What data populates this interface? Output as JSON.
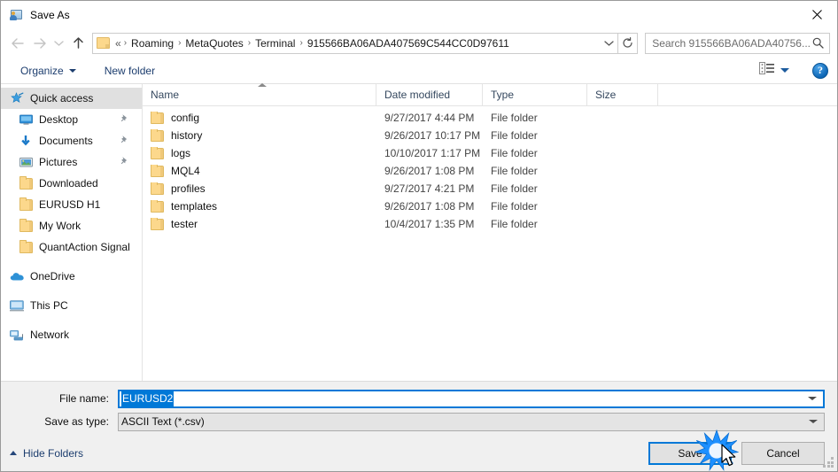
{
  "window": {
    "title": "Save As",
    "title_icon": "save-as-person-folder-icon",
    "close_label": "✕"
  },
  "nav": {
    "back_icon": "arrow-left-icon",
    "forward_icon": "arrow-right-icon",
    "recent_icon": "chevron-down-icon",
    "up_icon": "arrow-up-icon",
    "refresh_icon": "refresh-icon",
    "dropdown_icon": "chevron-down-icon",
    "folder_icon": "folder-icon",
    "breadcrumb_prefix": "«",
    "separator": "›",
    "crumbs": [
      "Roaming",
      "MetaQuotes",
      "Terminal",
      "915566BA06ADA407569C544CC0D97611"
    ]
  },
  "search": {
    "placeholder": "Search 915566BA06ADA40756...",
    "icon": "search-icon"
  },
  "toolbar": {
    "organize_label": "Organize",
    "new_folder_label": "New folder",
    "view_icon": "view-layout-icon",
    "help_label": "?"
  },
  "sidebar": {
    "items": [
      {
        "label": "Quick access",
        "icon": "star-pin-icon",
        "indent": "root",
        "selected": true,
        "pinned": false
      },
      {
        "label": "Desktop",
        "icon": "monitor-icon",
        "indent": "child",
        "selected": false,
        "pinned": true
      },
      {
        "label": "Documents",
        "icon": "download-arrow-icon",
        "indent": "child",
        "selected": false,
        "pinned": true
      },
      {
        "label": "Pictures",
        "icon": "picture-icon",
        "indent": "child",
        "selected": false,
        "pinned": true
      },
      {
        "label": "Downloaded",
        "icon": "folder-icon",
        "indent": "child",
        "selected": false,
        "pinned": false
      },
      {
        "label": "EURUSD H1",
        "icon": "folder-icon",
        "indent": "child",
        "selected": false,
        "pinned": false
      },
      {
        "label": "My Work",
        "icon": "folder-icon",
        "indent": "child",
        "selected": false,
        "pinned": false
      },
      {
        "label": "QuantAction Signal",
        "icon": "folder-icon",
        "indent": "child",
        "selected": false,
        "pinned": false
      },
      {
        "label": "OneDrive",
        "icon": "onedrive-cloud-icon",
        "indent": "root",
        "selected": false,
        "pinned": false,
        "gap_before": true
      },
      {
        "label": "This PC",
        "icon": "this-pc-icon",
        "indent": "root",
        "selected": false,
        "pinned": false,
        "gap_before": true
      },
      {
        "label": "Network",
        "icon": "network-icon",
        "indent": "root",
        "selected": false,
        "pinned": false,
        "gap_before": true
      }
    ]
  },
  "filelist": {
    "columns": [
      "Name",
      "Date modified",
      "Type",
      "Size"
    ],
    "sort_column": "Name",
    "sort_direction": "ascending",
    "rows": [
      {
        "name": "config",
        "date": "9/27/2017 4:44 PM",
        "type": "File folder",
        "size": ""
      },
      {
        "name": "history",
        "date": "9/26/2017 10:17 PM",
        "type": "File folder",
        "size": ""
      },
      {
        "name": "logs",
        "date": "10/10/2017 1:17 PM",
        "type": "File folder",
        "size": ""
      },
      {
        "name": "MQL4",
        "date": "9/26/2017 1:08 PM",
        "type": "File folder",
        "size": ""
      },
      {
        "name": "profiles",
        "date": "9/27/2017 4:21 PM",
        "type": "File folder",
        "size": ""
      },
      {
        "name": "templates",
        "date": "9/26/2017 1:08 PM",
        "type": "File folder",
        "size": ""
      },
      {
        "name": "tester",
        "date": "10/4/2017 1:35 PM",
        "type": "File folder",
        "size": ""
      }
    ]
  },
  "form": {
    "filename_label": "File name:",
    "filename_value": "EURUSD2",
    "filetype_label": "Save as type:",
    "filetype_value": "ASCII Text (*.csv)"
  },
  "footer": {
    "hide_folders_label": "Hide Folders",
    "save_label": "Save",
    "cancel_label": "Cancel"
  },
  "colors": {
    "accent": "#0078d7",
    "folder_yellow": "#fcd88c",
    "link_blue": "#1c3d6e",
    "selection_gray": "#e0e0e0"
  }
}
